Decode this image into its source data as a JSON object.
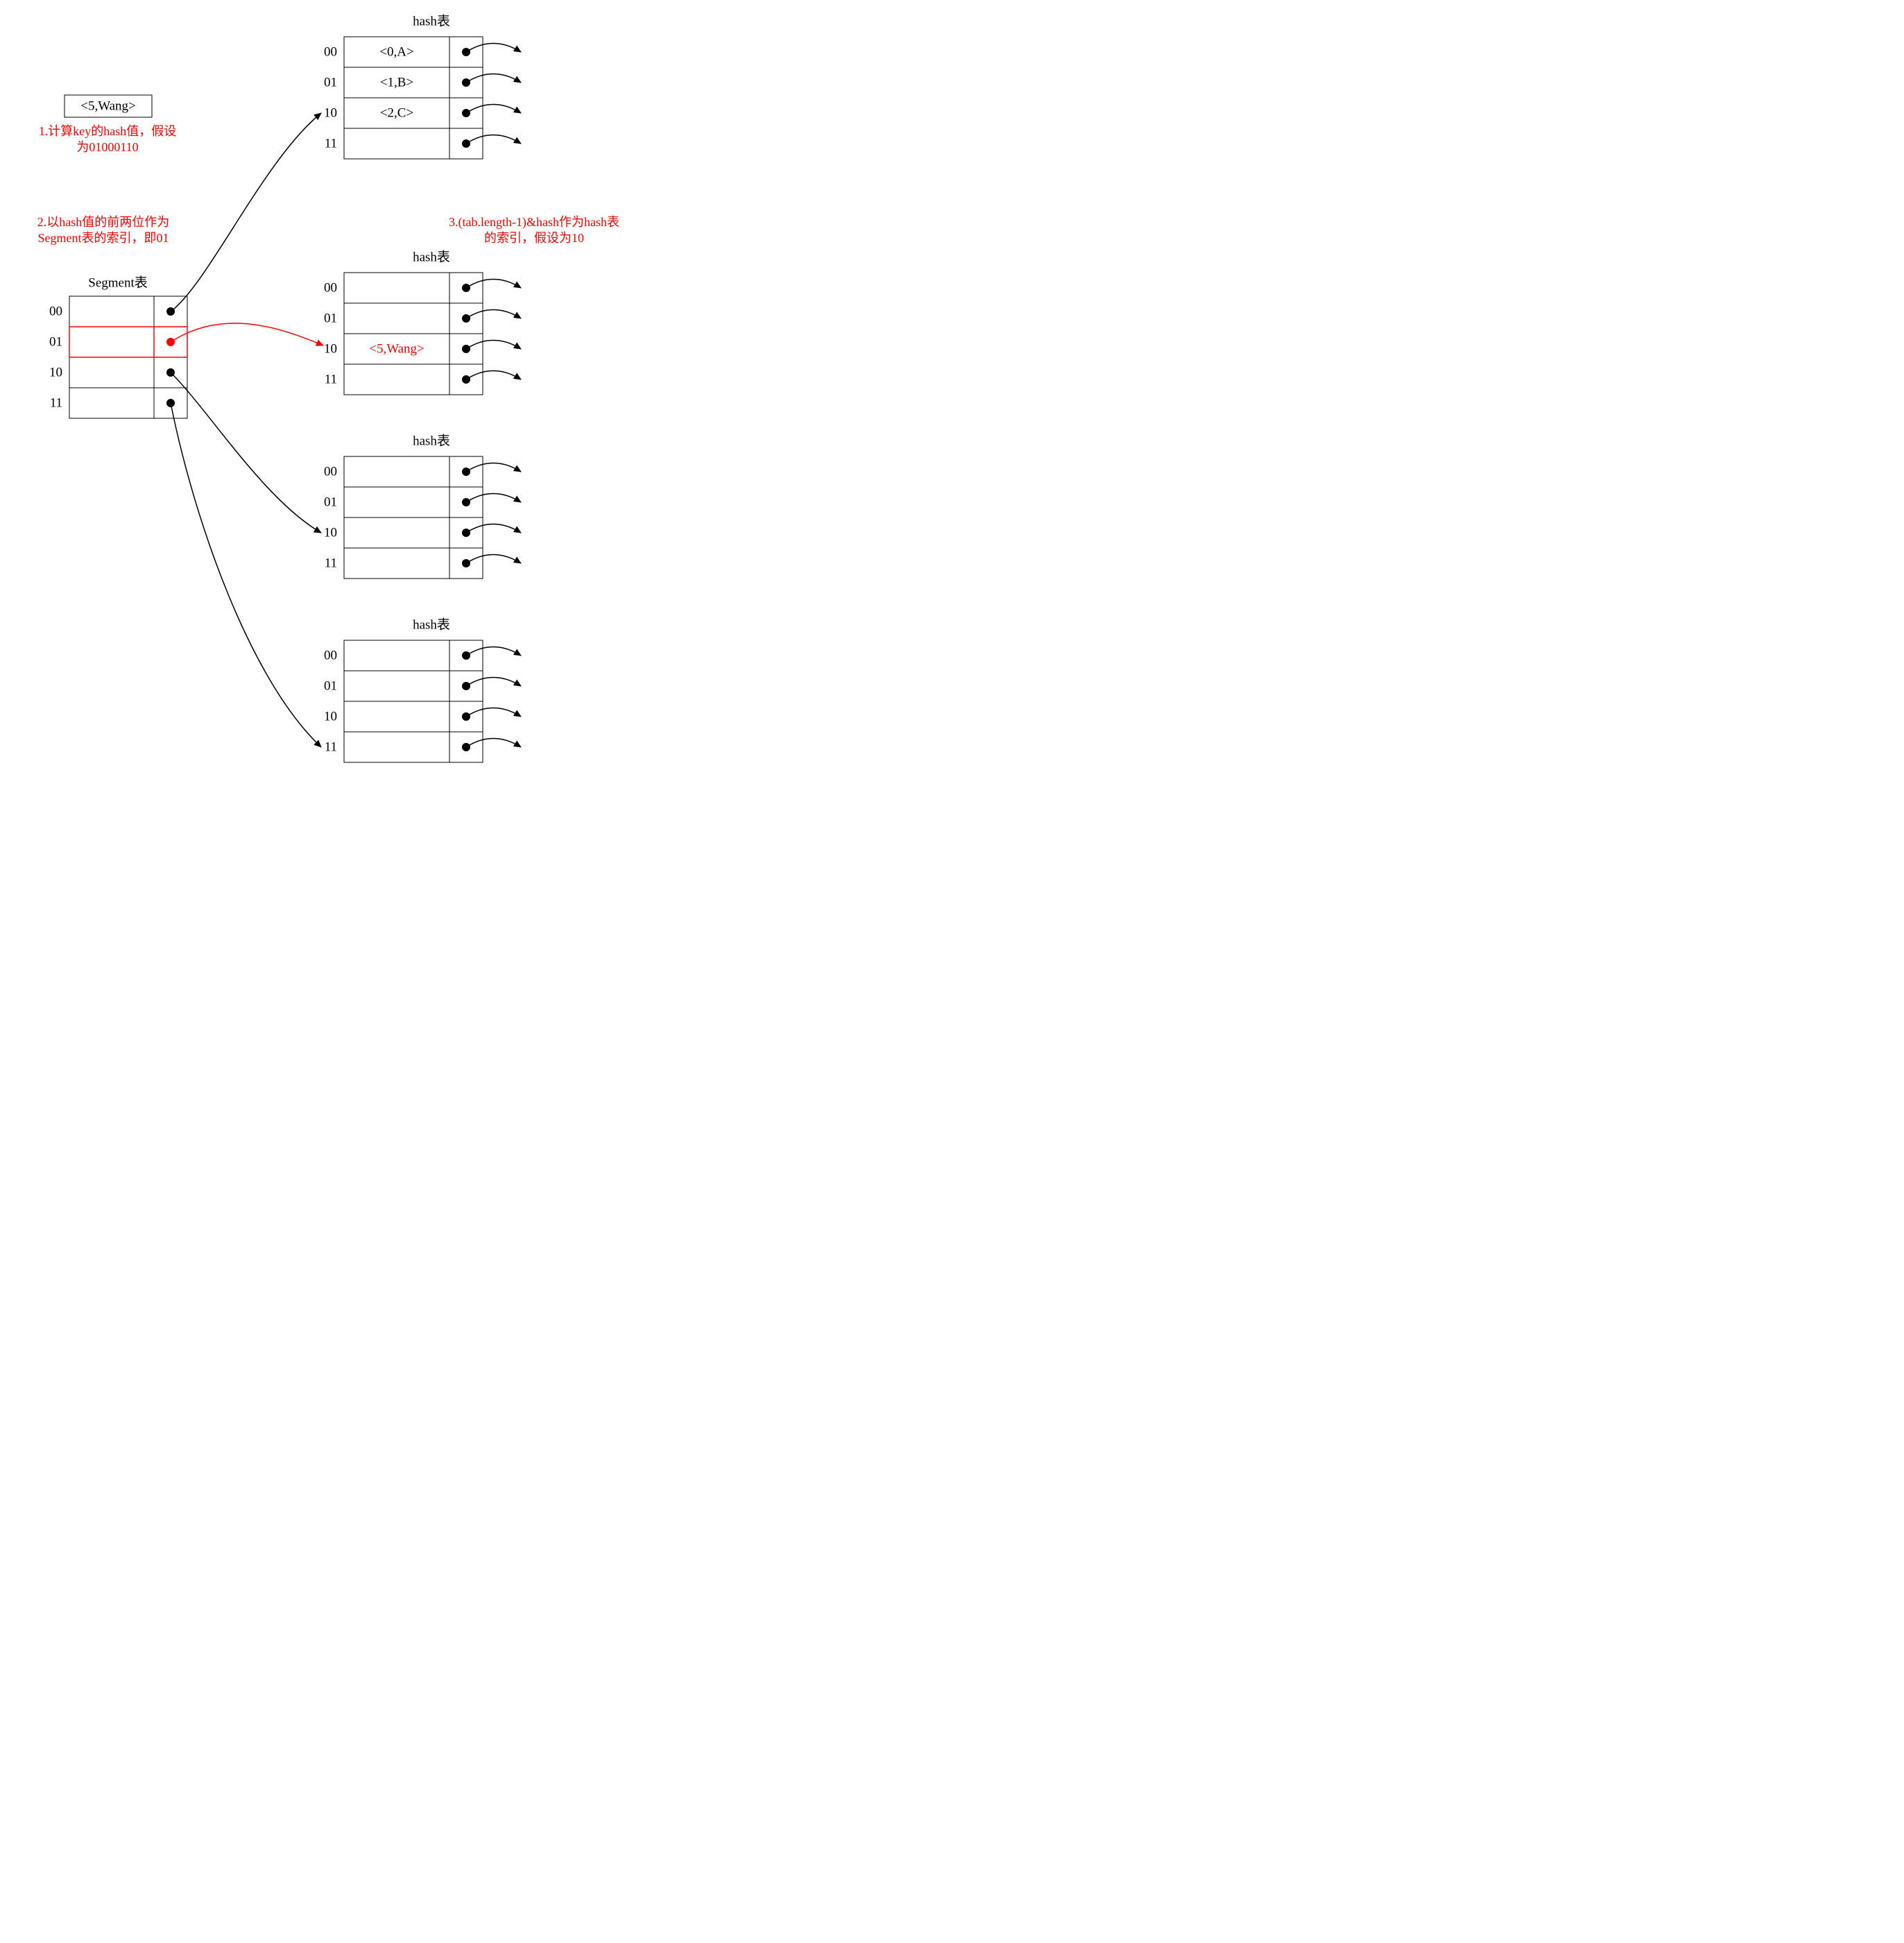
{
  "inputEntry": "<5,Wang>",
  "step1_line1": "1.计算key的hash值，假设",
  "step1_line2": "为01000110",
  "step2_line1": "2.以hash值的前两位作为",
  "step2_line2": "Segment表的索引，即01",
  "step3_line1": "3.(tab.length-1)&hash作为hash表",
  "step3_line2": "的索引，假设为10",
  "segmentTitle": "Segment表",
  "hashTitle": "hash表",
  "indices": [
    "00",
    "01",
    "10",
    "11"
  ],
  "hashTable1": [
    "<0,A>",
    "<1,B>",
    "<2,C>",
    ""
  ],
  "hashTable2": [
    "",
    "",
    "<5,Wang>",
    ""
  ],
  "hashTable3": [
    "",
    "",
    "",
    ""
  ],
  "hashTable4": [
    "",
    "",
    "",
    ""
  ]
}
